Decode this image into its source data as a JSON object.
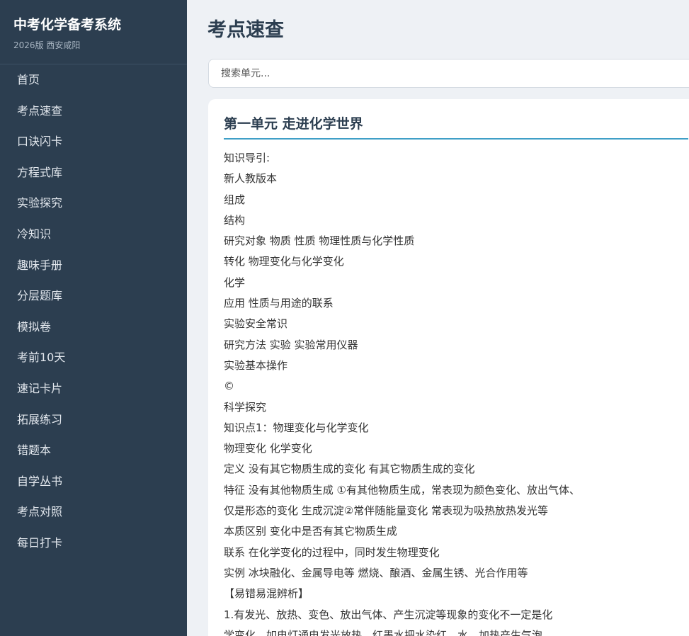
{
  "sidebar": {
    "title": "中考化学备考系统",
    "subtitle": "2026版 西安咸阳",
    "items": [
      {
        "label": "首页"
      },
      {
        "label": "考点速查"
      },
      {
        "label": "口诀闪卡"
      },
      {
        "label": "方程式库"
      },
      {
        "label": "实验探究"
      },
      {
        "label": "冷知识"
      },
      {
        "label": "趣味手册"
      },
      {
        "label": "分层题库"
      },
      {
        "label": "模拟卷"
      },
      {
        "label": "考前10天"
      },
      {
        "label": "速记卡片"
      },
      {
        "label": "拓展练习"
      },
      {
        "label": "错题本"
      },
      {
        "label": "自学丛书"
      },
      {
        "label": "考点对照"
      },
      {
        "label": "每日打卡"
      }
    ]
  },
  "main": {
    "title": "考点速查",
    "search": {
      "placeholder": "搜索单元...",
      "value": ""
    },
    "card": {
      "title": "第一单元 走进化学世界",
      "lines": [
        "知识导引:",
        "新人教版本",
        "组成",
        "结构",
        "研究对象 物质 性质 物理性质与化学性质",
        "转化 物理变化与化学变化",
        "化学",
        "应用 性质与用途的联系",
        "实验安全常识",
        "研究方法 实验 实验常用仪器",
        "实验基本操作",
        "©",
        "科学探究",
        "知识点1：物理变化与化学变化",
        "物理变化 化学变化",
        "定义 没有其它物质生成的变化 有其它物质生成的变化",
        "特征 没有其他物质生成 ①有其他物质生成，常表现为颜色变化、放出气体、",
        "仅是形态的变化 生成沉淀②常伴随能量变化 常表现为吸热放热发光等",
        "本质区别 变化中是否有其它物质生成",
        "联系 在化学变化的过程中，同时发生物理变化",
        "实例 冰块融化、金属导电等 燃烧、酿酒、金属生锈、光合作用等",
        "【易错易混辨析】",
        "1.有发光、放热、变色、放出气体、产生沉淀等现象的变化不一定是化",
        "学变化，如电灯通电发光放热、红墨水把水染红、水、加热产生气泡"
      ]
    }
  }
}
